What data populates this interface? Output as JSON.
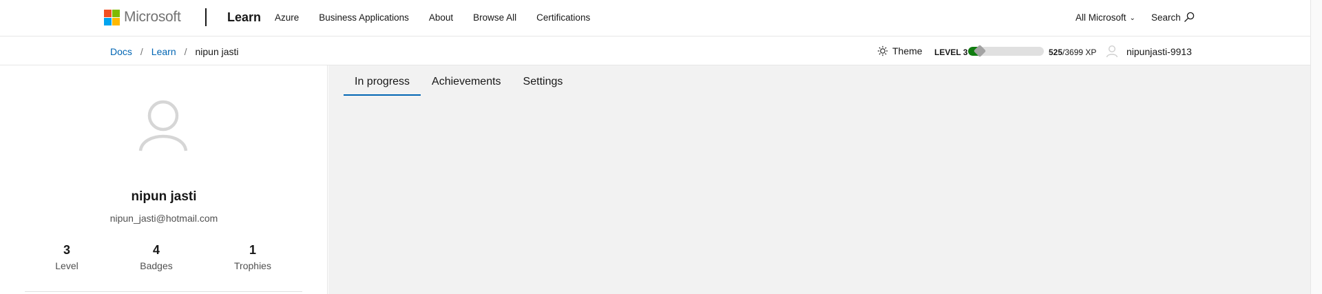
{
  "header": {
    "brand": "Microsoft",
    "logo_colors": [
      "#f25022",
      "#7fba00",
      "#00a4ef",
      "#ffb900"
    ],
    "site": "Learn",
    "nav": [
      "Azure",
      "Business Applications",
      "About",
      "Browse All",
      "Certifications"
    ],
    "all_microsoft": "All Microsoft",
    "search_label": "Search"
  },
  "subbar": {
    "breadcrumb": [
      "Docs",
      "Learn",
      "nipun jasti"
    ],
    "breadcrumb_separator": "/",
    "theme_label": "Theme",
    "level_label": "LEVEL 3",
    "xp_current": "525",
    "xp_total": "/3699 XP",
    "xp_progress_fraction": 0.142,
    "username": "nipunjasti-9913"
  },
  "profile": {
    "name": "nipun jasti",
    "email": "nipun_jasti@hotmail.com",
    "stats": {
      "level_value": "3",
      "level_label": "Level",
      "badges_value": "4",
      "badges_label": "Badges",
      "trophies_value": "1",
      "trophies_label": "Trophies"
    }
  },
  "main": {
    "tabs": [
      "In progress",
      "Achievements",
      "Settings"
    ],
    "active_tab": "In progress"
  },
  "colors": {
    "link": "#0065b3",
    "xp_fill": "#107c10",
    "main_bg": "#f2f2f2"
  }
}
